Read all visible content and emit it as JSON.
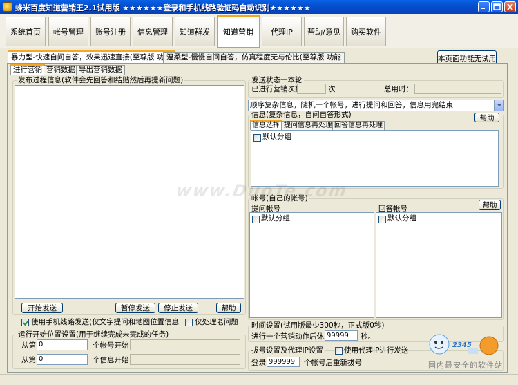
{
  "window": {
    "title": "蜂米百度知道营销王2.1试用版 ★★★★★★登录和手机线路验证码自动识别★★★★★★"
  },
  "main_tabs": [
    {
      "label": "系统首页"
    },
    {
      "label": "帐号管理"
    },
    {
      "label": "账号注册"
    },
    {
      "label": "信息管理"
    },
    {
      "label": "知道群发"
    },
    {
      "label": "知道营销"
    },
    {
      "label": "代理IP"
    },
    {
      "label": "帮助/意见"
    },
    {
      "label": "购买软件"
    }
  ],
  "mode_tabs": [
    {
      "label": "暴力型-快速自问自答，效果迅速直接(至尊版 功能"
    },
    {
      "label": "温柔型-慢慢自问自答，仿真程度无与伦比(至尊版 功能"
    }
  ],
  "no_trial_button": "本页面功能无试用",
  "sub_tabs": [
    {
      "label": "进行营销"
    },
    {
      "label": "营销数据"
    },
    {
      "label": "导出营销数据"
    }
  ],
  "publish_group": {
    "label": "发布过程信息(软件会先回答和结贴然后再提新问题)"
  },
  "left_buttons": {
    "start": "开始发送",
    "pause": "暂停发送",
    "stop": "停止发送",
    "help": "帮助"
  },
  "left_checks": {
    "phone_line": "使用手机线路发送(仅文字提问和地图位置信息",
    "old_only": "仅处理老问题"
  },
  "run_position": {
    "label": "运行开始位置设置(用于继续完成未完成的任务)",
    "from_label": "从第",
    "account_value": "0",
    "account_suffix": "个帐号开始",
    "info_value": "0",
    "info_suffix": "个信息开始"
  },
  "send_status": {
    "label": "发送状态一本轮",
    "count_label": "已进行营销次数",
    "count_unit": "次",
    "time_label": "总用时："
  },
  "mode_select": {
    "value": "顺序复杂信息，随机一个帐号，进行提问和回答，信息用完结束"
  },
  "info_group": {
    "label": "信息(复杂信息，自问自答形式)",
    "help": "帮助",
    "tabs": [
      {
        "label": "信息选择"
      },
      {
        "label": "提问信息再处理"
      },
      {
        "label": "回答信息再处理"
      }
    ],
    "default_group": "默认分组"
  },
  "account_group": {
    "label": "帐号(自己的帐号)",
    "help": "帮助",
    "ask_label": "提问帐号",
    "answer_label": "回答帐号",
    "ask_default": "默认分组",
    "answer_default": "默认分组"
  },
  "time_group": {
    "label": "时间设置(试用版最少300秒，正式版0秒)",
    "prefix": "进行一个营销动作后休息",
    "value": "99999",
    "unit": "秒。"
  },
  "dial_group": {
    "label": "拔号设置及代理IP设置",
    "proxy_check": "使用代理IP进行发送",
    "login_label": "登录",
    "login_value": "999999",
    "login_suffix": "个帐号后重新拔号"
  },
  "watermark": "www.DuoTe.com",
  "bottom_watermark": "国内最安全的软件站",
  "corner_logo": "2345"
}
